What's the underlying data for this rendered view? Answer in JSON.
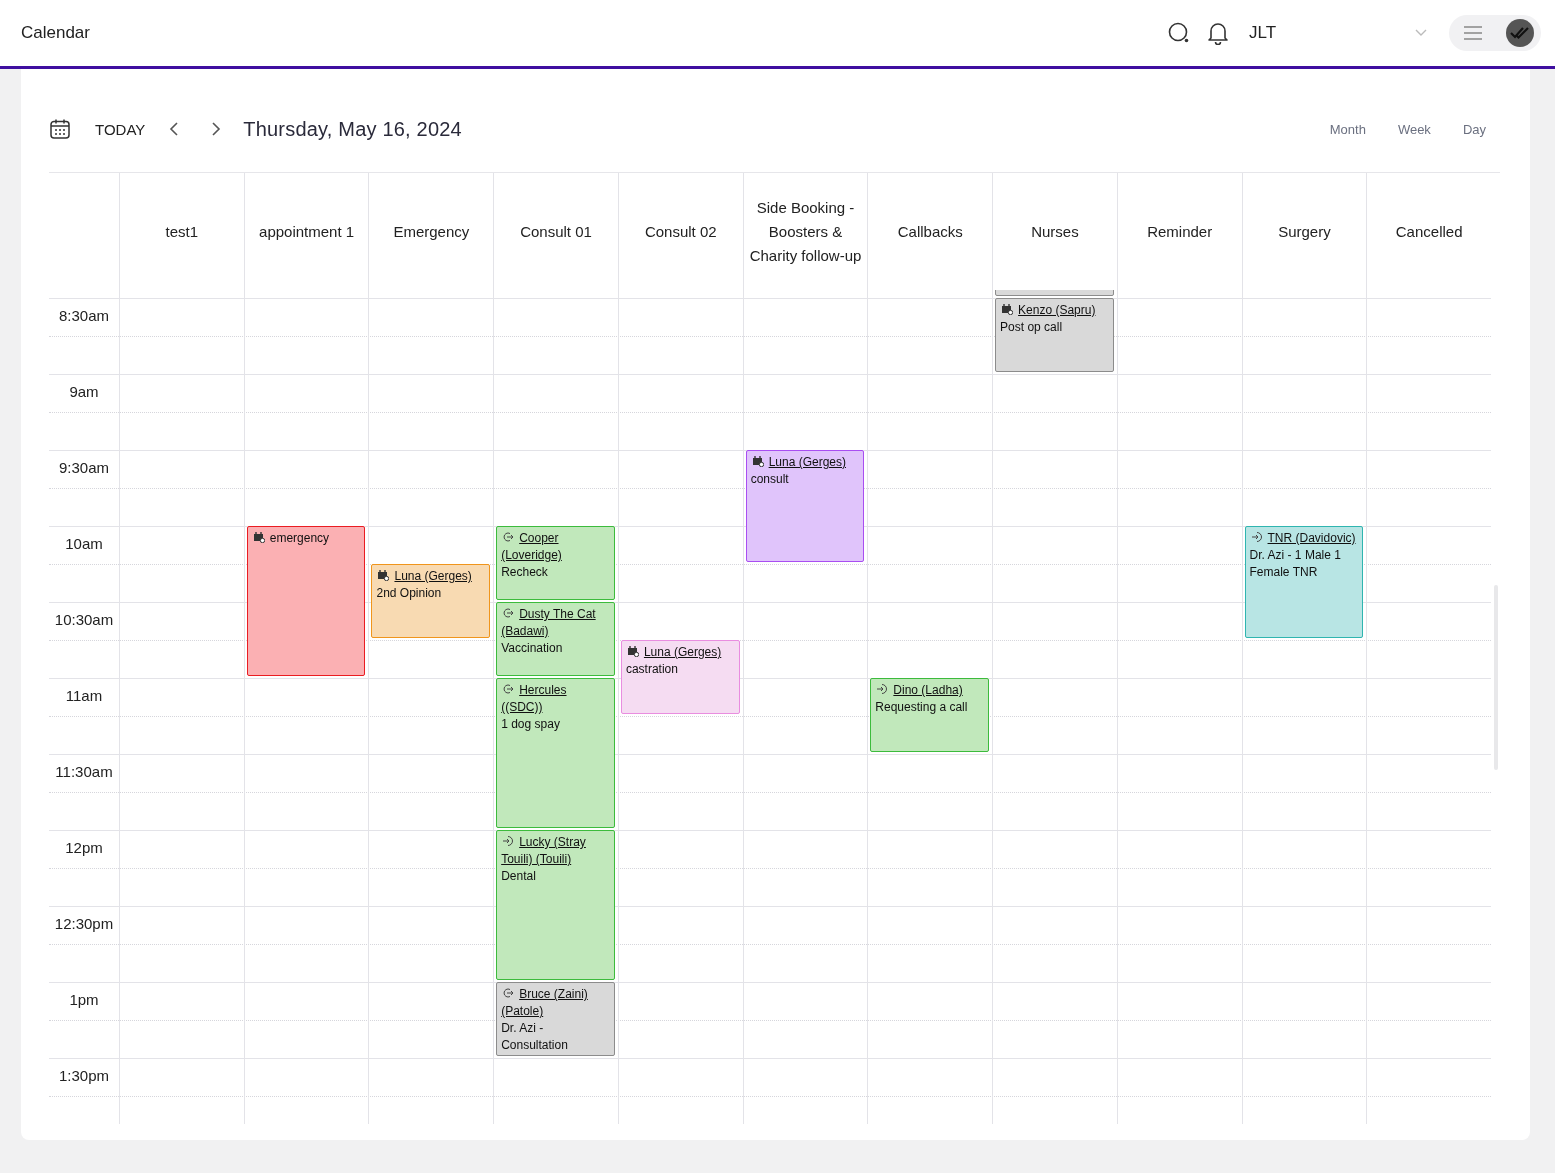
{
  "app_bar": {
    "title": "Calendar",
    "user": "JLT"
  },
  "toolbar": {
    "today": "TODAY",
    "date": "Thursday, May 16, 2024",
    "views": [
      "Month",
      "Week",
      "Day"
    ]
  },
  "time_labels": [
    "8:30am",
    "9am",
    "9:30am",
    "10am",
    "10:30am",
    "11am",
    "11:30am",
    "12pm",
    "12:30pm",
    "1pm",
    "1:30pm"
  ],
  "resources": [
    {
      "name": "test1"
    },
    {
      "name": "appointment 1",
      "events": [
        {
          "kind": "booking",
          "color": "#fbb0b3",
          "text": "emergency"
        }
      ]
    },
    {
      "name": "Emergency",
      "events": [
        {
          "kind": "booking",
          "color": "#f8dab2",
          "link": "Luna (Gerges)",
          "text": "2nd Opinion"
        }
      ]
    },
    {
      "name": "Consult 01",
      "events": [
        {
          "kind": "return",
          "color": "#c1e8bb",
          "link": "Cooper (Loveridge)",
          "text": "Recheck"
        },
        {
          "kind": "return",
          "color": "#c1e8bb",
          "link": "Dusty The Cat (Badawi)",
          "text": "Vaccination"
        },
        {
          "kind": "return",
          "color": "#c1e8bb",
          "link": "Hercules ((SDC))",
          "text": "1 dog spay"
        },
        {
          "kind": "arrived",
          "color": "#c1e8bb",
          "link": "Lucky (Stray Touili) (Touili)",
          "text": "Dental"
        },
        {
          "kind": "return",
          "color": "#d9d9d9",
          "link": "Bruce (Zaini) (Patole)",
          "text": "Dr. Azi - Consultation"
        }
      ]
    },
    {
      "name": "Consult 02",
      "events": [
        {
          "kind": "booking",
          "color": "#f5dcf2",
          "link": "Luna (Gerges)",
          "text": "castration"
        }
      ]
    },
    {
      "name": "Side Booking - Boosters & Charity follow-up",
      "events": [
        {
          "kind": "booking",
          "color": "#e0c4fb",
          "link": "Luna (Gerges)",
          "text": "consult"
        }
      ]
    },
    {
      "name": "Callbacks",
      "events": [
        {
          "kind": "arrived",
          "color": "#c1e8bb",
          "link": "Dino (Ladha)",
          "text": "Requesting a call"
        }
      ]
    },
    {
      "name": "Nurses",
      "events": [
        {
          "color": "#d9d9d9"
        },
        {
          "kind": "booking",
          "color": "#d9d9d9",
          "link": "Kenzo (Sapru)",
          "text": "Post op call"
        }
      ]
    },
    {
      "name": "Reminder"
    },
    {
      "name": "Surgery",
      "events": [
        {
          "kind": "arrived",
          "color": "#b8e5e4",
          "link": "TNR (Davidovic)",
          "text": "Dr. Azi - 1 Male 1 Female TNR"
        }
      ]
    },
    {
      "name": "Cancelled"
    }
  ]
}
